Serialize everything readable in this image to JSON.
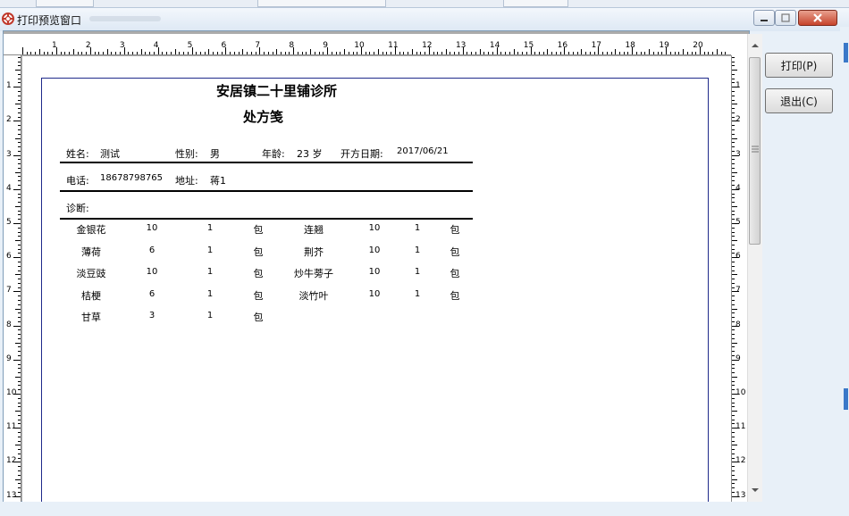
{
  "window": {
    "title": "打印预览窗口",
    "colors": {
      "border": "#1f2a8a",
      "close": "#c7432b"
    }
  },
  "toolbar": {
    "print_label": "打印(P)",
    "exit_label": "退出(C)"
  },
  "ruler": {
    "top_numbers": [
      "1",
      "2",
      "3",
      "4",
      "5",
      "6",
      "7",
      "8",
      "9",
      "10",
      "11",
      "12",
      "13",
      "14",
      "15",
      "16",
      "17",
      "18",
      "19",
      "20"
    ],
    "side_numbers": [
      "1",
      "2",
      "3",
      "4",
      "5",
      "6",
      "7",
      "8",
      "9",
      "10",
      "11",
      "12",
      "13"
    ]
  },
  "prescription": {
    "clinic_name": "安居镇二十里铺诊所",
    "form_title": "处方笺",
    "patient": {
      "name_label": "姓名:",
      "name": "测试",
      "sex_label": "性别:",
      "sex": "男",
      "age_label": "年龄:",
      "age": "23 岁",
      "date_label": "开方日期:",
      "date": "2017/06/21",
      "phone_label": "电话:",
      "phone": "18678798765",
      "address_label": "地址:",
      "address": "蒋1",
      "diagnosis_label": "诊断:"
    },
    "herbs": [
      {
        "name": "金银花",
        "qty": "10",
        "doses": "1",
        "unit": "包"
      },
      {
        "name": "连翘",
        "qty": "10",
        "doses": "1",
        "unit": "包"
      },
      {
        "name": "薄荷",
        "qty": "6",
        "doses": "1",
        "unit": "包"
      },
      {
        "name": "荆芥",
        "qty": "10",
        "doses": "1",
        "unit": "包"
      },
      {
        "name": "淡豆豉",
        "qty": "10",
        "doses": "1",
        "unit": "包"
      },
      {
        "name": "炒牛蒡子",
        "qty": "10",
        "doses": "1",
        "unit": "包"
      },
      {
        "name": "桔梗",
        "qty": "6",
        "doses": "1",
        "unit": "包"
      },
      {
        "name": "淡竹叶",
        "qty": "10",
        "doses": "1",
        "unit": "包"
      },
      {
        "name": "甘草",
        "qty": "3",
        "doses": "1",
        "unit": "包"
      }
    ]
  }
}
